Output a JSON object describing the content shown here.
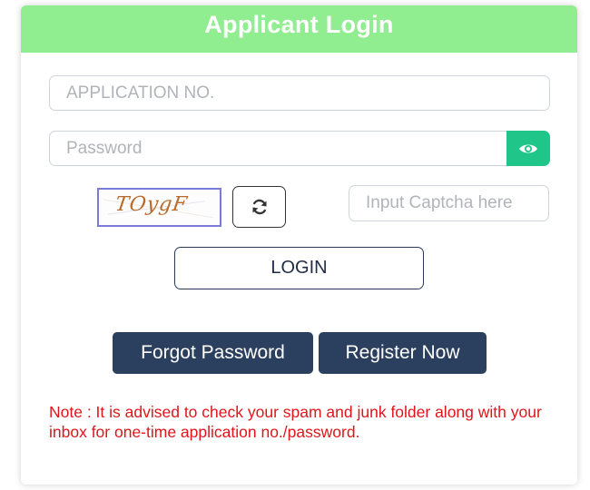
{
  "header": {
    "title": "Applicant Login"
  },
  "form": {
    "application_no_placeholder": "APPLICATION NO.",
    "password_placeholder": "Password",
    "captcha_text": "TOygF",
    "captcha_input_placeholder": "Input Captcha here",
    "login_label": "LOGIN"
  },
  "actions": {
    "forgot_password_label": "Forgot Password",
    "register_now_label": "Register Now"
  },
  "note": {
    "text": "Note : It is advised to check your spam and junk folder along with your inbox for one-time application no./password."
  },
  "colors": {
    "header_bg": "#90ee90",
    "eye_button": "#20c58a",
    "dark_button": "#2b3f5e",
    "note_text": "#e0151b"
  },
  "icons": {
    "show_password": "eye-icon",
    "refresh_captcha": "refresh-icon"
  }
}
